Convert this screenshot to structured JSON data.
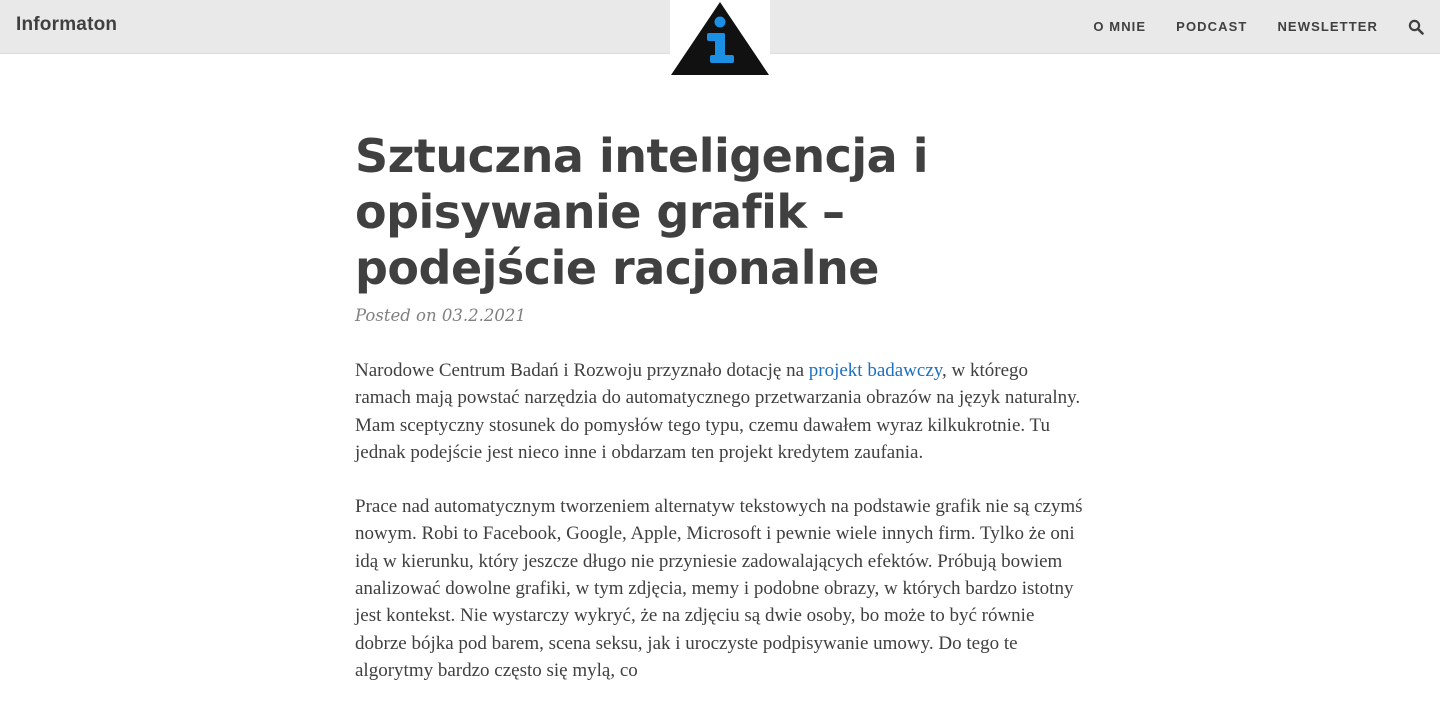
{
  "header": {
    "site_title": "Informaton",
    "nav": [
      {
        "label": "O MNIE"
      },
      {
        "label": "PODCAST"
      },
      {
        "label": "NEWSLETTER"
      }
    ],
    "search_icon": "search-icon",
    "logo_colors": {
      "triangle": "#111111",
      "letter": "#1a8fe3"
    }
  },
  "article": {
    "title": "Sztuczna inteligencja i opisywanie grafik – podejście racjonalne",
    "meta": "Posted on 03.2.2021",
    "paragraphs": [
      {
        "before_link": "Narodowe Centrum Badań i Rozwoju przyznało dotację na ",
        "link_text": "projekt badawczy",
        "after_link": ", w którego ramach mają powstać narzędzia do automatycznego przetwarzania obrazów na język naturalny. Mam sceptyczny stosunek do pomysłów tego typu, czemu dawałem wyraz kilkukrotnie. Tu jednak podejście jest nieco inne i obdarzam ten projekt kredytem zaufania."
      },
      {
        "text": "Prace nad automatycznym tworzeniem alternatyw tekstowych na podstawie grafik nie są czymś nowym. Robi to Facebook, Google, Apple, Microsoft i pewnie wiele innych firm. Tylko że oni idą w kierunku, który jeszcze długo nie przyniesie zadowalających efektów. Próbują bowiem analizować dowolne grafiki, w tym zdjęcia, memy i podobne obrazy, w których bardzo istotny jest kontekst. Nie wystarczy wykryć, że na zdjęciu są dwie osoby, bo może to być równie dobrze bójka pod barem, scena seksu, jak i uroczyste podpisywanie umowy. Do tego te algorytmy bardzo często się mylą, co"
      }
    ]
  },
  "colors": {
    "topbar_bg": "#e9e9e9",
    "text": "#404040",
    "meta": "#808080",
    "link": "#1d6fc0"
  }
}
